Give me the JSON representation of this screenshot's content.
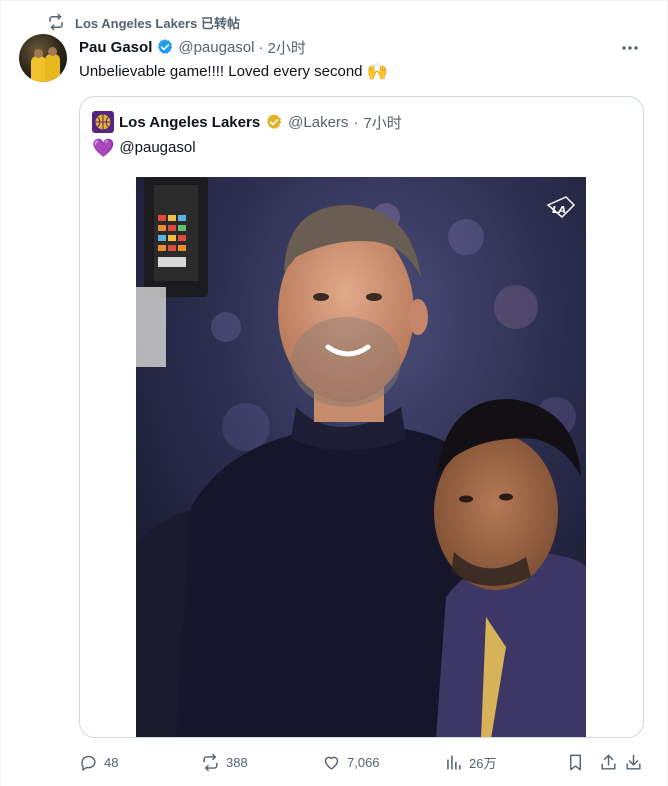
{
  "repost": {
    "label": "Los Angeles Lakers 已转帖",
    "icon": "repost-icon"
  },
  "tweet": {
    "author_name": "Pau Gasol",
    "handle": "@paugasol",
    "separator": "·",
    "time": "2小时",
    "text": "Unbelievable game!!!! Loved every second",
    "emoji": "🙌"
  },
  "quote": {
    "author_name": "Los Angeles Lakers",
    "handle": "@Lakers",
    "separator": "·",
    "time": "7小时",
    "heart_emoji": "💜",
    "mention": "@paugasol",
    "watermark": "LA"
  },
  "actions": {
    "replies": "48",
    "reposts": "388",
    "likes": "7,066",
    "views": "26万"
  },
  "colors": {
    "muted": "#536471",
    "verified_blue": "#1d9bf0",
    "lakers_gold": "#e2b325",
    "lakers_purple": "#552583"
  }
}
